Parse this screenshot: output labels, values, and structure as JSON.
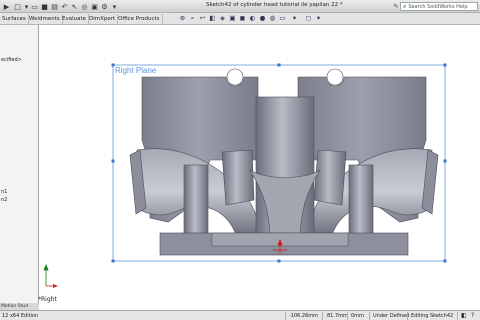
{
  "window": {
    "title": "Sketch42 of cylinder head tutorial ile yapilan 22 *",
    "help_search_placeholder": "Search SolidWorks Help"
  },
  "command_tabs": [
    "Surfaces",
    "Weldments",
    "Evaluate",
    "DimXpert",
    "Office Products"
  ],
  "feature_tree": {
    "items": [
      "ecified>",
      "n1",
      "n2"
    ],
    "motion_tab": "Motion Stud"
  },
  "viewport": {
    "plane_label": "Right Plane",
    "view_name": "*Right"
  },
  "status_bar": {
    "left": "12 x64 Edition",
    "x": "-106.26mm",
    "y": "81.7mm",
    "z": "0mm",
    "state": "Under Defined",
    "editing": "Editing Sketch42"
  },
  "colors": {
    "part": "#8a8c9a",
    "part_light": "#a9abb8",
    "part_dark": "#5f6170",
    "plane_border": "#5f95d8",
    "origin": "#d41818"
  }
}
